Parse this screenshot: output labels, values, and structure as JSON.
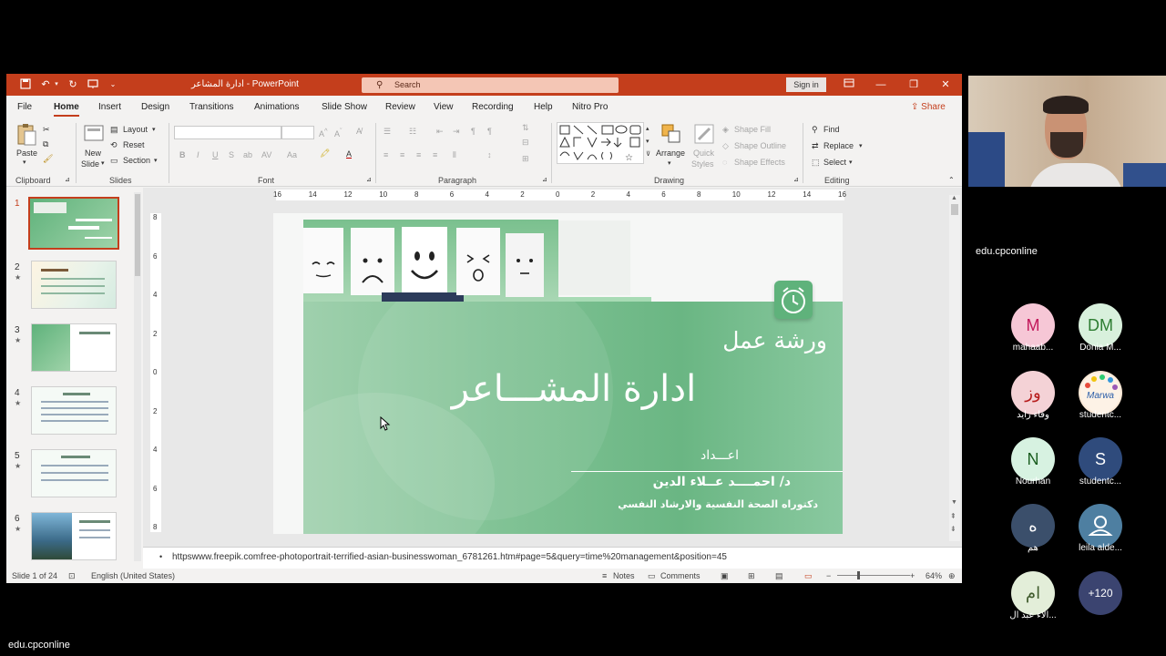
{
  "window": {
    "doc_title": "ادارة المشاعر  -  PowerPoint",
    "search_placeholder": "Search",
    "signin_label": "Sign in",
    "share_label": "Share"
  },
  "menu": [
    "File",
    "Home",
    "Insert",
    "Design",
    "Transitions",
    "Animations",
    "Slide Show",
    "Review",
    "View",
    "Recording",
    "Help",
    "Nitro Pro"
  ],
  "ribbon": {
    "clipboard": {
      "label": "Clipboard",
      "paste": "Paste"
    },
    "slides": {
      "label": "Slides",
      "new_slide": "New",
      "new_slide2": "Slide",
      "layout": "Layout",
      "reset": "Reset",
      "section": "Section"
    },
    "font": {
      "label": "Font"
    },
    "paragraph": {
      "label": "Paragraph"
    },
    "drawing": {
      "label": "Drawing",
      "arrange": "Arrange",
      "quick_styles": "Quick",
      "quick_styles2": "Styles",
      "shape_fill": "Shape Fill",
      "shape_outline": "Shape Outline",
      "shape_effects": "Shape Effects"
    },
    "editing": {
      "label": "Editing",
      "find": "Find",
      "replace": "Replace",
      "select": "Select"
    }
  },
  "ruler": {
    "ticks": [
      "16",
      "14",
      "12",
      "10",
      "8",
      "6",
      "4",
      "2",
      "0",
      "2",
      "4",
      "6",
      "8",
      "10",
      "12",
      "14",
      "16"
    ],
    "vticks": [
      "8",
      "6",
      "4",
      "2",
      "0",
      "2",
      "4",
      "6",
      "8"
    ]
  },
  "thumbs": [
    {
      "num": "1",
      "star": ""
    },
    {
      "num": "2",
      "star": "★"
    },
    {
      "num": "3",
      "star": "★"
    },
    {
      "num": "4",
      "star": "★"
    },
    {
      "num": "5",
      "star": "★"
    },
    {
      "num": "6",
      "star": "★"
    }
  ],
  "slide": {
    "workshop": "ورشة عمل",
    "title": "ادارة المشـــاعر",
    "prepared_by": "اعـــداد",
    "author": "د/ احمــــد عــلاء الدين",
    "author_title": "دكتوراه الصحة النفسية والارشاد النفسي"
  },
  "notes": {
    "text": "httpswww.freepik.comfree-photoportrait-terrified-asian-businesswoman_6781261.htm#page=5&query=time%20management&position=45"
  },
  "status": {
    "slide_count": "Slide 1 of 24",
    "language": "English (United States)",
    "notes_btn": "Notes",
    "comments_btn": "Comments",
    "zoom": "64%"
  },
  "zoom_panel": {
    "host_label": "edu.cpconline",
    "bottom_label": "edu.cpconline",
    "participants": [
      {
        "initials": "M",
        "name": "mahaab...",
        "color": "#f6c7d6",
        "fg": "#c2185b"
      },
      {
        "initials": "DM",
        "name": "Donia M...",
        "color": "#d8f0dc",
        "fg": "#2e7d32"
      },
      {
        "initials": "وز",
        "name": "وفاء زايد",
        "color": "#f4d2d6",
        "fg": "#b71c1c"
      },
      {
        "initials": "",
        "name": "studentc...",
        "color": "#fbe9d7",
        "fg": "#333333"
      },
      {
        "initials": "N",
        "name": "Nourhan",
        "color": "#d7f2e1",
        "fg": "#1b5e20"
      },
      {
        "initials": "S",
        "name": "studentc...",
        "color": "#2f4b7c",
        "fg": "#ffffff"
      },
      {
        "initials": "ه",
        "name": "هم",
        "color": "#3b4f6b",
        "fg": "#ffffff"
      },
      {
        "initials": "",
        "name": "leila alde...",
        "color": "#4e7fa1",
        "fg": "#ffffff"
      },
      {
        "initials": "ام",
        "name": "الاء عبد ال...",
        "color": "#e3eed9",
        "fg": "#3e5a2b"
      },
      {
        "initials": "+120",
        "name": "",
        "color": "#3b4470",
        "fg": "#ffffff"
      }
    ]
  }
}
